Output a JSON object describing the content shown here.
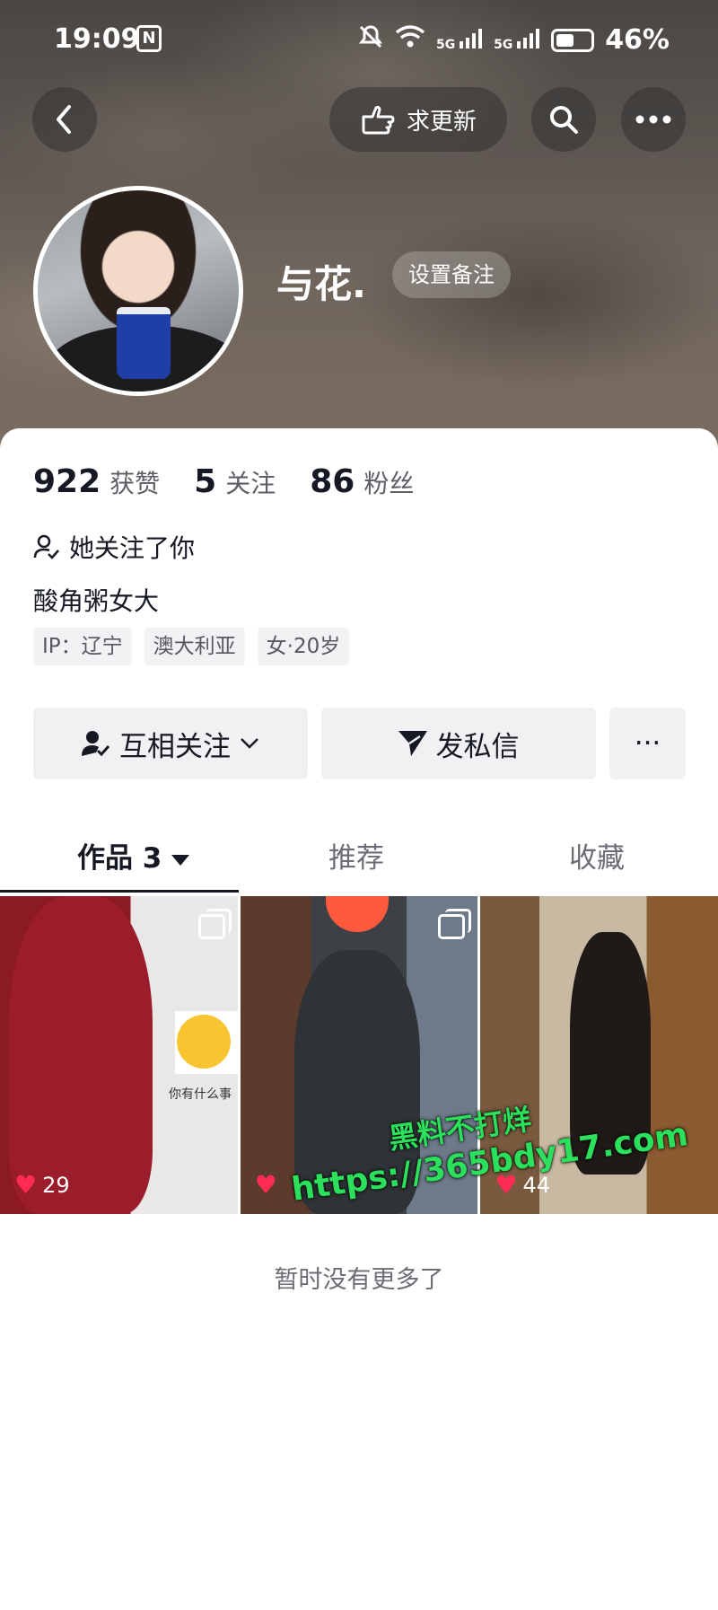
{
  "status_bar": {
    "time": "19:09",
    "nfc_icon": "N",
    "network_1": "5G",
    "network_2": "5G",
    "battery_percent": "46%",
    "battery_level": 0.46
  },
  "header": {
    "update_button_label": "求更新",
    "icons": {
      "back": "chevron-left-icon",
      "update": "pointing-hand-icon",
      "search": "search-icon",
      "more": "more-dots-icon"
    }
  },
  "profile": {
    "nickname": "与花.",
    "remark_button": "设置备注"
  },
  "stats": {
    "likes_count": "922",
    "likes_label": "获赞",
    "following_count": "5",
    "following_label": "关注",
    "followers_count": "86",
    "followers_label": "粉丝"
  },
  "follow_status": "她关注了你",
  "bio": "酸角粥女大",
  "tags": [
    "IP：辽宁",
    "澳大利亚",
    "女·20岁"
  ],
  "actions": {
    "mutual_label": "互相关注",
    "dm_label": "发私信",
    "more_label": "···"
  },
  "tabs": {
    "works_label": "作品 3",
    "recommend_label": "推荐",
    "favorites_label": "收藏"
  },
  "posts": [
    {
      "likes": "29"
    },
    {
      "likes": ""
    },
    {
      "likes": "44"
    }
  ],
  "thumb_overlay_text": "你有什么事",
  "watermark": {
    "line1": "黑料不打烊",
    "line2": "https://365bdy17.com"
  },
  "footer_message": "暂时没有更多了",
  "colors": {
    "heart": "#fe2c55",
    "watermark": "#2be05a",
    "button_bg": "#f1f1f3"
  }
}
